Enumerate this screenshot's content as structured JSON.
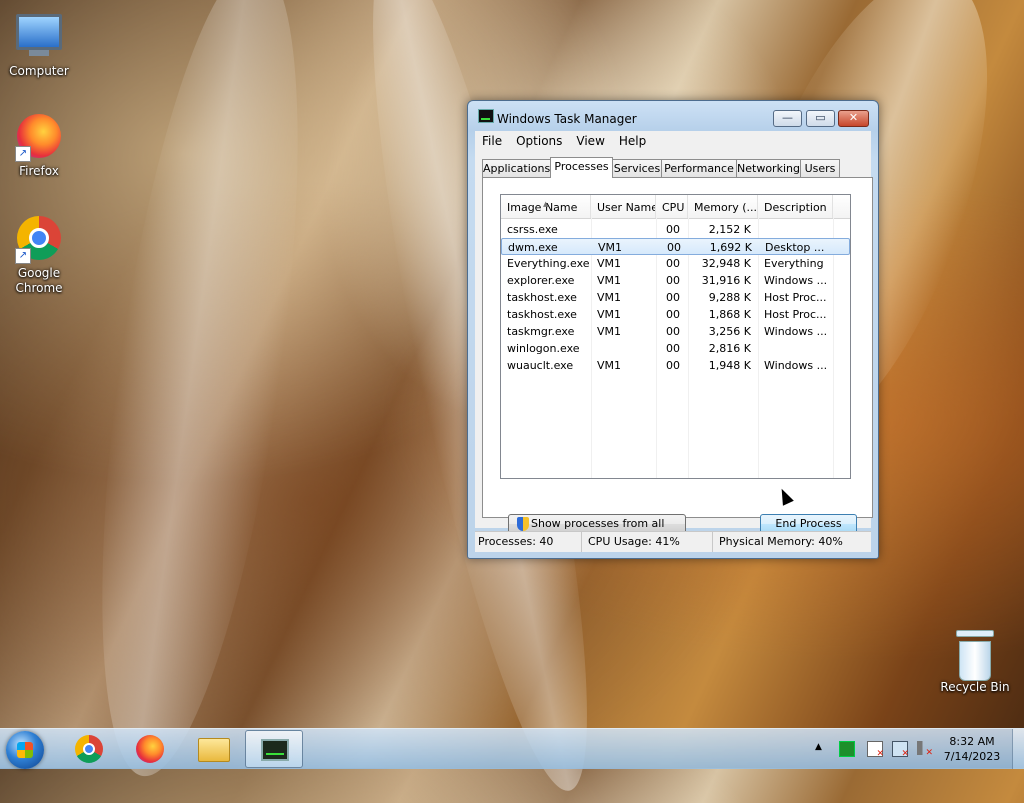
{
  "desktop": {
    "icons": [
      {
        "label": "Computer"
      },
      {
        "label": "Firefox"
      },
      {
        "label": "Google Chrome"
      },
      {
        "label": "Recycle Bin"
      }
    ]
  },
  "window": {
    "title": "Windows Task Manager",
    "controls": {
      "minimize": "—",
      "maximize": "▭",
      "close": "✕"
    },
    "menu": [
      "File",
      "Options",
      "View",
      "Help"
    ],
    "tabs": [
      "Applications",
      "Processes",
      "Services",
      "Performance",
      "Networking",
      "Users"
    ],
    "active_tab": "Processes",
    "columns": [
      "Image Name",
      "User Name",
      "CPU",
      "Memory (...",
      "Description"
    ],
    "processes": [
      {
        "image": "csrss.exe",
        "user": "",
        "cpu": "00",
        "memory": "2,152 K",
        "description": ""
      },
      {
        "image": "dwm.exe",
        "user": "VM1",
        "cpu": "00",
        "memory": "1,692 K",
        "description": "Desktop ..."
      },
      {
        "image": "Everything.exe",
        "user": "VM1",
        "cpu": "00",
        "memory": "32,948 K",
        "description": "Everything"
      },
      {
        "image": "explorer.exe",
        "user": "VM1",
        "cpu": "00",
        "memory": "31,916 K",
        "description": "Windows ..."
      },
      {
        "image": "taskhost.exe",
        "user": "VM1",
        "cpu": "00",
        "memory": "9,288 K",
        "description": "Host Proc..."
      },
      {
        "image": "taskhost.exe",
        "user": "VM1",
        "cpu": "00",
        "memory": "1,868 K",
        "description": "Host Proc..."
      },
      {
        "image": "taskmgr.exe",
        "user": "VM1",
        "cpu": "00",
        "memory": "3,256 K",
        "description": "Windows ..."
      },
      {
        "image": "winlogon.exe",
        "user": "",
        "cpu": "00",
        "memory": "2,816 K",
        "description": ""
      },
      {
        "image": "wuauclt.exe",
        "user": "VM1",
        "cpu": "00",
        "memory": "1,948 K",
        "description": "Windows ..."
      }
    ],
    "selected_index": 1,
    "show_all_button": "Show processes from all users",
    "end_process_button": "End Process",
    "status": {
      "processes": "Processes: 40",
      "cpu": "CPU Usage: 41%",
      "memory": "Physical Memory: 40%"
    }
  },
  "taskbar": {
    "clock_time": "8:32 AM",
    "clock_date": "7/14/2023",
    "tray_arrow": "▲"
  }
}
